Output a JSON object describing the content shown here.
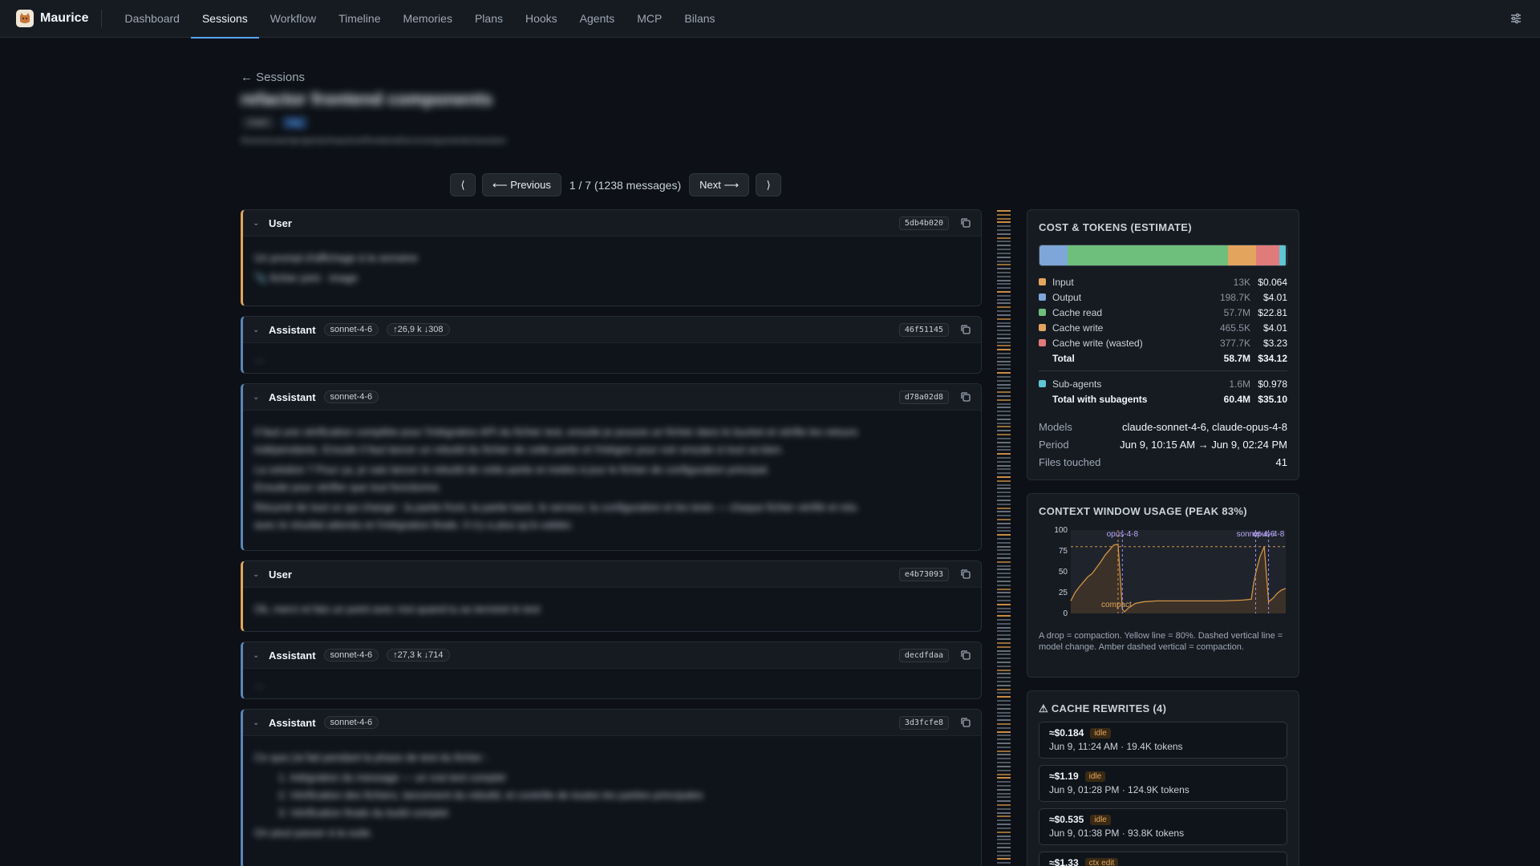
{
  "app": {
    "name": "Maurice"
  },
  "nav": {
    "items": [
      {
        "label": "Dashboard"
      },
      {
        "label": "Sessions"
      },
      {
        "label": "Workflow"
      },
      {
        "label": "Timeline"
      },
      {
        "label": "Memories"
      },
      {
        "label": "Plans"
      },
      {
        "label": "Hooks"
      },
      {
        "label": "Agents"
      },
      {
        "label": "MCP"
      },
      {
        "label": "Bilans"
      }
    ],
    "active": "Sessions"
  },
  "header": {
    "back_label": "← Sessions",
    "title": "refactor frontend components",
    "tags": [
      "main",
      "tag"
    ],
    "path": "/home/user/projects/maurice/frontend/src/components/session"
  },
  "pager": {
    "first": "⟨",
    "prev": "⟵ Previous",
    "info": "1 / 7 (1238 messages)",
    "next": "Next ⟶",
    "last": "⟩"
  },
  "messages": [
    {
      "role": "User",
      "id": "5db4b020",
      "lines": [
        "Un prompt d'affichage à la semaine",
        "📎 fichier joint · image"
      ]
    },
    {
      "role": "Assistant",
      "model": "sonnet-4-6",
      "tokens": "↑26,9 k ↓308",
      "id": "46f51145",
      "lines": [
        "…"
      ]
    },
    {
      "role": "Assistant",
      "model": "sonnet-4-6",
      "id": "d78a02d8",
      "lines": [
        "Il faut une vérification complète pour l'intégration API du fichier test, ensuite je pousse un fichier dans le bucket et vérifie les retours",
        "indépendants. Ensuite il faut lancer un rebuild du fichier de cette partie et l'intégrer pour voir ensuite si tout va bien.",
        "La solution ? Pour ça, je vais lancer le rebuild de cette partie et mettre à jour le fichier de configuration principal.",
        "Ensuite pour vérifier que tout fonctionne.",
        "Résumé de tout ce qui change : la partie front, la partie back, le serveur, la configuration et les tests — chaque fichier vérifié et relu",
        "avec le résultat attendu et l'intégration finale. Il n'y a plus qu'à valider."
      ]
    },
    {
      "role": "User",
      "id": "e4b73093",
      "lines": [
        "Ok, merci et fais un point avec moi quand tu as terminé le test"
      ]
    },
    {
      "role": "Assistant",
      "model": "sonnet-4-6",
      "tokens": "↑27,3 k ↓714",
      "id": "decdfdaa",
      "lines": [
        "…"
      ]
    },
    {
      "role": "Assistant",
      "model": "sonnet-4-6",
      "id": "3d3fcfe8",
      "lines": [
        "Ce que j'ai fait pendant la phase de test du fichier :",
        "1. Intégration du message — un vrai test complet",
        "2. Vérification des fichiers, lancement du rebuild, et contrôle de toutes les parties principales",
        "3. Vérification finale du build complet",
        "On peut passer à la suite."
      ]
    }
  ],
  "cost": {
    "title": "COST & TOKENS (ESTIMATE)",
    "rows": [
      {
        "name": "Input",
        "value": "13K",
        "cost": "$0.064",
        "color": "#e3a55d",
        "amount": 0.064
      },
      {
        "name": "Output",
        "value": "198.7K",
        "cost": "$4.01",
        "color": "#7ea6d8",
        "amount": 4.01
      },
      {
        "name": "Cache read",
        "value": "57.7M",
        "cost": "$22.81",
        "color": "#6fbf7c",
        "amount": 22.81
      },
      {
        "name": "Cache write",
        "value": "465.5K",
        "cost": "$4.01",
        "color": "#e3a55d",
        "amount": 4.01
      },
      {
        "name": "Cache write (wasted)",
        "value": "377.7K",
        "cost": "$3.23",
        "color": "#e07b7b",
        "amount": 3.23
      }
    ],
    "total": {
      "name": "Total",
      "value": "58.7M",
      "cost": "$34.12"
    },
    "subagents": {
      "name": "Sub-agents",
      "value": "1.6M",
      "cost": "$0.978",
      "color": "#5ec6d3",
      "amount": 0.978
    },
    "total_with": {
      "name": "Total with subagents",
      "value": "60.4M",
      "cost": "$35.10"
    },
    "models_label": "Models",
    "models": "claude-sonnet-4-6, claude-opus-4-8",
    "period_label": "Period",
    "period": "Jun 9, 10:15 AM → Jun 9, 02:24 PM",
    "files_label": "Files touched",
    "files": "41"
  },
  "context": {
    "title": "CONTEXT WINDOW USAGE (PEAK 83%)",
    "note": "A drop = compaction. Yellow line = 80%. Dashed vertical line = model change. Amber dashed vertical = compaction.",
    "chart_data": {
      "type": "area",
      "y_ticks": [
        "100",
        "75",
        "50",
        "25",
        "0"
      ],
      "ylim": [
        0,
        100
      ],
      "threshold": 80,
      "x": [
        0,
        2,
        4,
        6,
        8,
        10,
        12,
        14,
        16,
        18,
        20,
        22,
        24,
        25,
        27,
        30,
        34,
        40,
        50,
        60,
        70,
        80,
        84,
        85,
        86,
        87,
        88,
        90,
        92,
        94,
        96,
        98,
        100
      ],
      "y": [
        15,
        25,
        32,
        38,
        44,
        48,
        55,
        62,
        70,
        76,
        82,
        83,
        5,
        2,
        7,
        12,
        14,
        15,
        15,
        15,
        15,
        16,
        17,
        35,
        48,
        58,
        68,
        80,
        14,
        18,
        24,
        28,
        30
      ],
      "markers": [
        {
          "label": "opus-4-8",
          "x": 24,
          "kind": "model"
        },
        {
          "label": "compact",
          "x": 22,
          "kind": "compaction"
        },
        {
          "label": "sonnet-4-6",
          "x": 86,
          "kind": "model"
        },
        {
          "label": "opus-4-8",
          "x": 92,
          "kind": "model"
        }
      ]
    }
  },
  "rewrites": {
    "title": "⚠ CACHE REWRITES (4)",
    "items": [
      {
        "cost": "≈$0.184",
        "badge": "idle",
        "sub": "Jun 9, 11:24 AM · 19.4K tokens"
      },
      {
        "cost": "≈$1.19",
        "badge": "idle",
        "sub": "Jun 9, 01:28 PM · 124.9K tokens"
      },
      {
        "cost": "≈$0.535",
        "badge": "idle",
        "sub": "Jun 9, 01:38 PM · 93.8K tokens"
      },
      {
        "cost": "≈$1.33",
        "badge": "ctx edit",
        "sub": ""
      }
    ]
  }
}
